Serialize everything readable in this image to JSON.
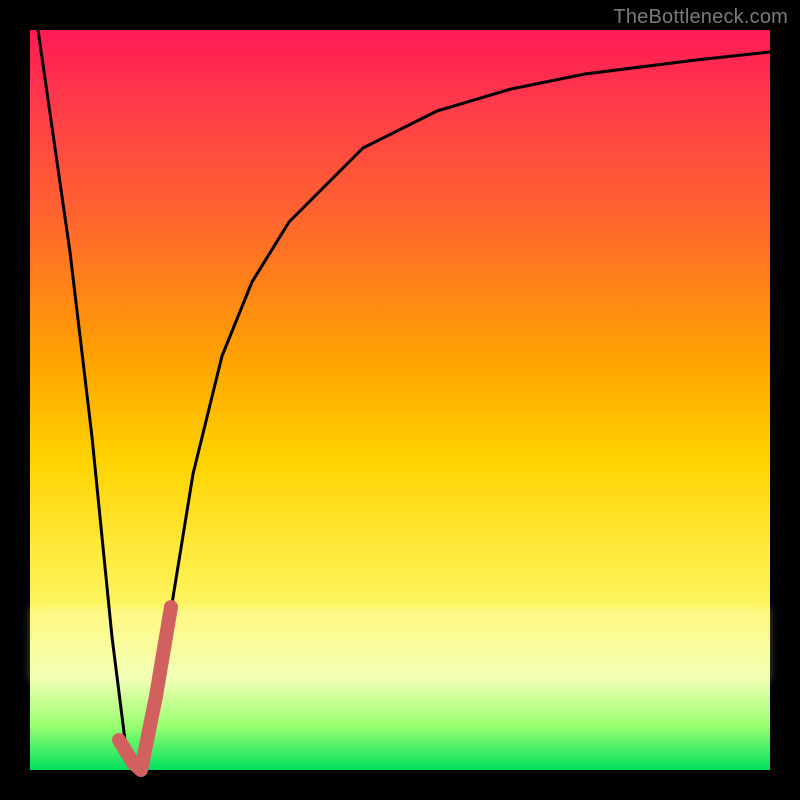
{
  "watermark": {
    "text": "TheBottleneck.com"
  },
  "colors": {
    "gradient_top": "#ff1a55",
    "gradient_mid": "#ffd200",
    "gradient_bottom": "#00e060",
    "curve": "#000000",
    "accent_nub": "#d1605e",
    "frame": "#000000"
  },
  "chart_data": {
    "type": "line",
    "title": "",
    "xlabel": "",
    "ylabel": "",
    "xlim": [
      0,
      100
    ],
    "ylim": [
      0,
      100
    ],
    "grid": false,
    "legend_position": "none",
    "series": [
      {
        "name": "bottleneck-curve",
        "color": "#000000",
        "x": [
          1,
          5,
          8,
          11,
          13,
          15,
          18,
          22,
          26,
          30,
          35,
          45,
          55,
          65,
          75,
          90,
          100
        ],
        "y": [
          100,
          70,
          45,
          18,
          3,
          0,
          15,
          40,
          56,
          66,
          74,
          84,
          89,
          92,
          94,
          96,
          97
        ]
      },
      {
        "name": "accent-nub",
        "color": "#d1605e",
        "x": [
          12,
          14,
          15,
          17,
          19
        ],
        "y": [
          4,
          1,
          0,
          10,
          22
        ]
      }
    ],
    "annotations": [
      {
        "text": "TheBottleneck.com",
        "position": "top-right",
        "color": "#7a7a7a"
      }
    ]
  }
}
